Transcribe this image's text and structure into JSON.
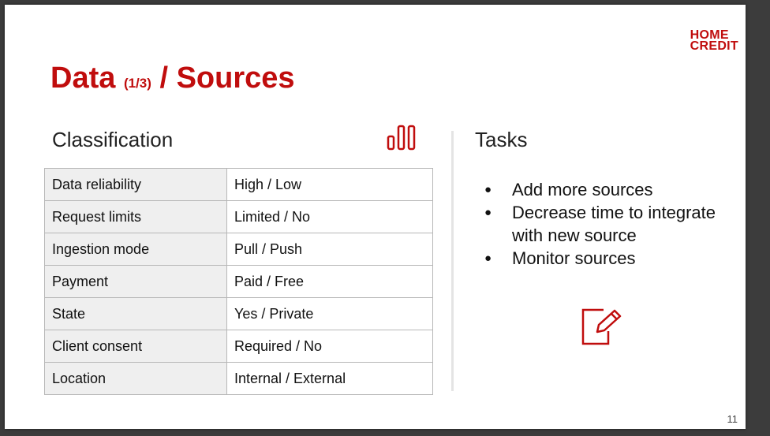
{
  "logo": {
    "line1": "HOME",
    "line2": "CREDIT"
  },
  "title": {
    "main": "Data",
    "sub": "(1/3)",
    "rest": "/ Sources"
  },
  "classification": {
    "heading": "Classification",
    "rows": [
      {
        "key": "Data reliability",
        "value": "High / Low"
      },
      {
        "key": "Request limits",
        "value": "Limited / No"
      },
      {
        "key": "Ingestion mode",
        "value": "Pull / Push"
      },
      {
        "key": "Payment",
        "value": "Paid / Free"
      },
      {
        "key": "State",
        "value": "Yes / Private"
      },
      {
        "key": "Client consent",
        "value": "Required / No"
      },
      {
        "key": "Location",
        "value": "Internal / External"
      }
    ]
  },
  "tasks": {
    "heading": "Tasks",
    "items": [
      "Add more sources",
      "Decrease time to integrate with new source",
      "Monitor sources"
    ]
  },
  "page_number": "11",
  "icons": {
    "chart": "bar-chart-icon",
    "edit": "edit-document-icon"
  },
  "colors": {
    "brand_red": "#c00d0d"
  }
}
